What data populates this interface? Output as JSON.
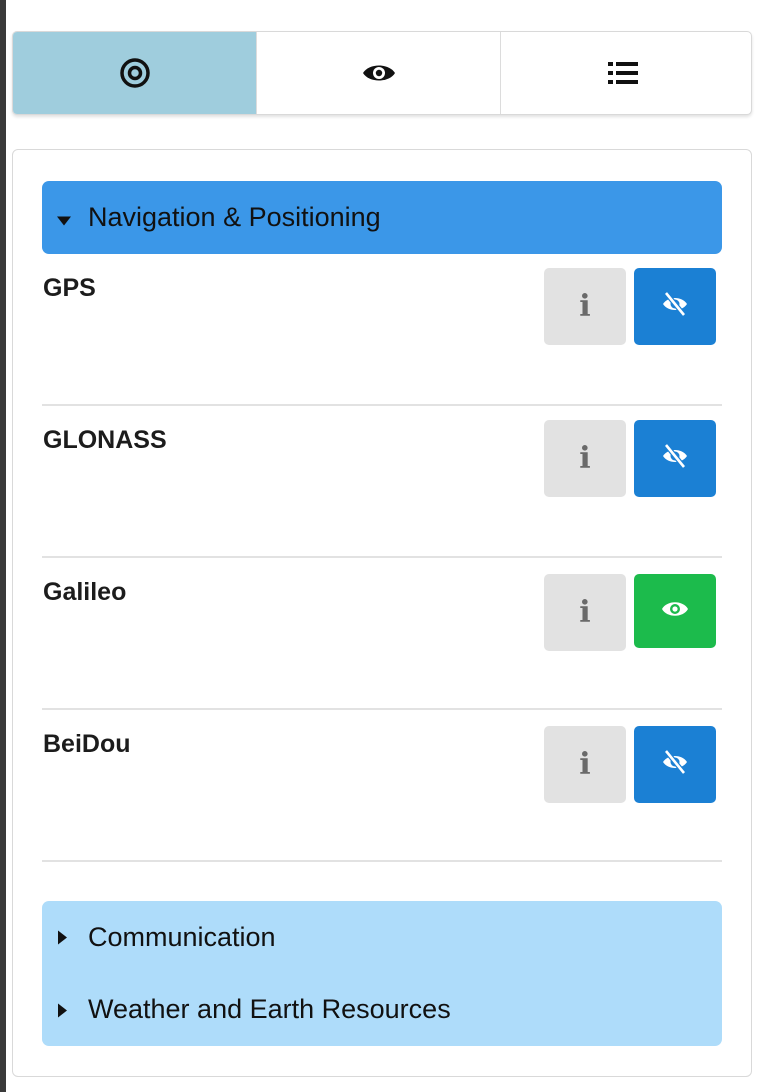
{
  "tabs": [
    {
      "icon": "target-icon",
      "active": true
    },
    {
      "icon": "eye-icon",
      "active": false
    },
    {
      "icon": "list-icon",
      "active": false
    }
  ],
  "sections": {
    "navigation": {
      "label": "Navigation & Positioning",
      "expanded": true
    },
    "communication": {
      "label": "Communication",
      "expanded": false
    },
    "weather": {
      "label": "Weather and Earth Resources",
      "expanded": false
    }
  },
  "satellites": [
    {
      "name": "GPS",
      "visible": false,
      "info_icon": "info-icon",
      "visibility_icon": "eye-slash-icon"
    },
    {
      "name": "GLONASS",
      "visible": false,
      "info_icon": "info-icon",
      "visibility_icon": "eye-slash-icon"
    },
    {
      "name": "Galileo",
      "visible": true,
      "info_icon": "info-icon",
      "visibility_icon": "eye-icon"
    },
    {
      "name": "BeiDou",
      "visible": false,
      "info_icon": "info-icon",
      "visibility_icon": "eye-slash-icon"
    }
  ],
  "colors": {
    "active_tab": "#9fcddd",
    "expanded_header": "#3b97e8",
    "collapsed_header": "#aedcfa",
    "hidden_button": "#1b80d4",
    "visible_button": "#1cbb4c",
    "info_button": "#e2e2e2"
  }
}
